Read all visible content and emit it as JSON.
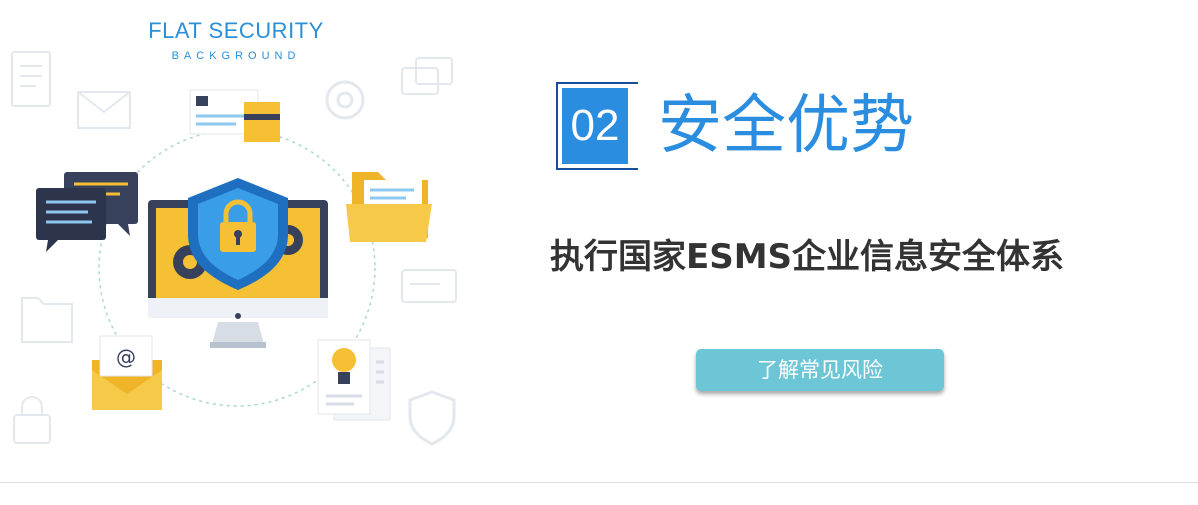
{
  "brand": {
    "title": "FLAT SECURITY",
    "subtitle": "BACKGROUND"
  },
  "section": {
    "number": "02",
    "title": "安全优势"
  },
  "tagline": "执行国家ESMS企业信息安全体系",
  "cta": {
    "label": "了解常见风险"
  },
  "illustration": {
    "icons": [
      "security-shield-icon",
      "lock-icon",
      "gear-icon",
      "monitor-icon",
      "id-card-icon",
      "folder-icon",
      "chat-bubbles-icon",
      "email-envelope-icon",
      "lightbulb-document-icon"
    ]
  },
  "colors": {
    "accent": "#2b8de0",
    "accent_dark": "#1a4f9c",
    "button": "#6cc6d6",
    "text": "#333333",
    "yellow": "#f5c033",
    "navy": "#37415c"
  }
}
